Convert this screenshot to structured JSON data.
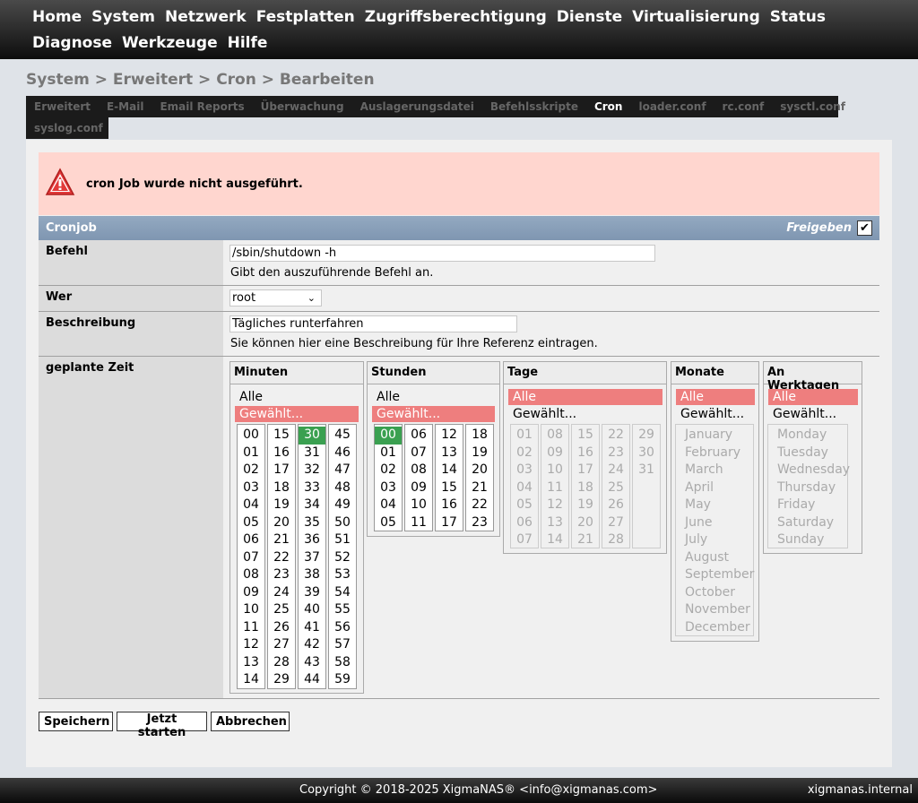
{
  "nav": [
    "Home",
    "System",
    "Netzwerk",
    "Festplatten",
    "Zugriffsberechtigung",
    "Dienste",
    "Virtualisierung",
    "Status",
    "Diagnose",
    "Werkzeuge",
    "Hilfe"
  ],
  "breadcrumb": "System > Erweitert > Cron > Bearbeiten",
  "tabs": [
    "Erweitert",
    "E-Mail",
    "Email Reports",
    "Überwachung",
    "Auslagerungsdatei",
    "Befehlsskripte",
    "Cron",
    "loader.conf",
    "rc.conf",
    "sysctl.conf"
  ],
  "tabs2": [
    "syslog.conf"
  ],
  "active_tab": "Cron",
  "error": {
    "message": "cron Job wurde nicht ausgeführt."
  },
  "form": {
    "title": "Cronjob",
    "enable_label": "Freigeben",
    "command": {
      "label": "Befehl",
      "value": "/sbin/shutdown -h",
      "help": "Gibt den auszuführende Befehl an."
    },
    "who": {
      "label": "Wer",
      "value": "root"
    },
    "description": {
      "label": "Beschreibung",
      "value": "Tägliches runterfahren",
      "help": "Sie können hier eine Beschreibung für Ihre Referenz eintragen."
    },
    "schedule_label": "geplante Zeit"
  },
  "schedule": {
    "all": "Alle",
    "selected": "Gewählt...",
    "minutes": {
      "title": "Minuten",
      "mode": "Gewählt...",
      "columns": [
        [
          "00",
          "01",
          "02",
          "03",
          "04",
          "05",
          "06",
          "07",
          "08",
          "09",
          "10",
          "11",
          "12",
          "13",
          "14"
        ],
        [
          "15",
          "16",
          "17",
          "18",
          "19",
          "20",
          "21",
          "22",
          "23",
          "24",
          "25",
          "26",
          "27",
          "28",
          "29"
        ],
        [
          "30",
          "31",
          "32",
          "33",
          "34",
          "35",
          "36",
          "37",
          "38",
          "39",
          "40",
          "41",
          "42",
          "43",
          "44"
        ],
        [
          "45",
          "46",
          "47",
          "48",
          "49",
          "50",
          "51",
          "52",
          "53",
          "54",
          "55",
          "56",
          "57",
          "58",
          "59"
        ]
      ],
      "chosen": [
        "30"
      ]
    },
    "hours": {
      "title": "Stunden",
      "mode": "Gewählt...",
      "columns": [
        [
          "00",
          "01",
          "02",
          "03",
          "04",
          "05"
        ],
        [
          "06",
          "07",
          "08",
          "09",
          "10",
          "11"
        ],
        [
          "12",
          "13",
          "14",
          "15",
          "16",
          "17"
        ],
        [
          "18",
          "19",
          "20",
          "21",
          "22",
          "23"
        ]
      ],
      "chosen": [
        "00"
      ]
    },
    "days": {
      "title": "Tage",
      "mode": "Alle",
      "columns": [
        [
          "01",
          "02",
          "03",
          "04",
          "05",
          "06",
          "07"
        ],
        [
          "08",
          "09",
          "10",
          "11",
          "12",
          "13",
          "14"
        ],
        [
          "15",
          "16",
          "17",
          "18",
          "19",
          "20",
          "21"
        ],
        [
          "22",
          "23",
          "24",
          "25",
          "26",
          "27",
          "28"
        ],
        [
          "29",
          "30",
          "31"
        ]
      ]
    },
    "months": {
      "title": "Monate",
      "mode": "Alle",
      "items": [
        "January",
        "February",
        "March",
        "April",
        "May",
        "June",
        "July",
        "August",
        "September",
        "October",
        "November",
        "December"
      ]
    },
    "weekdays": {
      "title": "An Werktagen",
      "mode": "Alle",
      "items": [
        "Monday",
        "Tuesday",
        "Wednesday",
        "Thursday",
        "Friday",
        "Saturday",
        "Sunday"
      ]
    }
  },
  "buttons": {
    "save": "Speichern",
    "run_now": "Jetzt starten",
    "cancel": "Abbrechen"
  },
  "footer": {
    "copyright": "Copyright © 2018-2025 XigmaNAS® <info@xigmanas.com>",
    "host": "xigmanas.internal"
  },
  "colors": {
    "selected_red": "#ee7e7e",
    "selected_green": "#3aa050",
    "error_bg": "#ffd6cf",
    "header_blue": "#8aa0b9"
  }
}
